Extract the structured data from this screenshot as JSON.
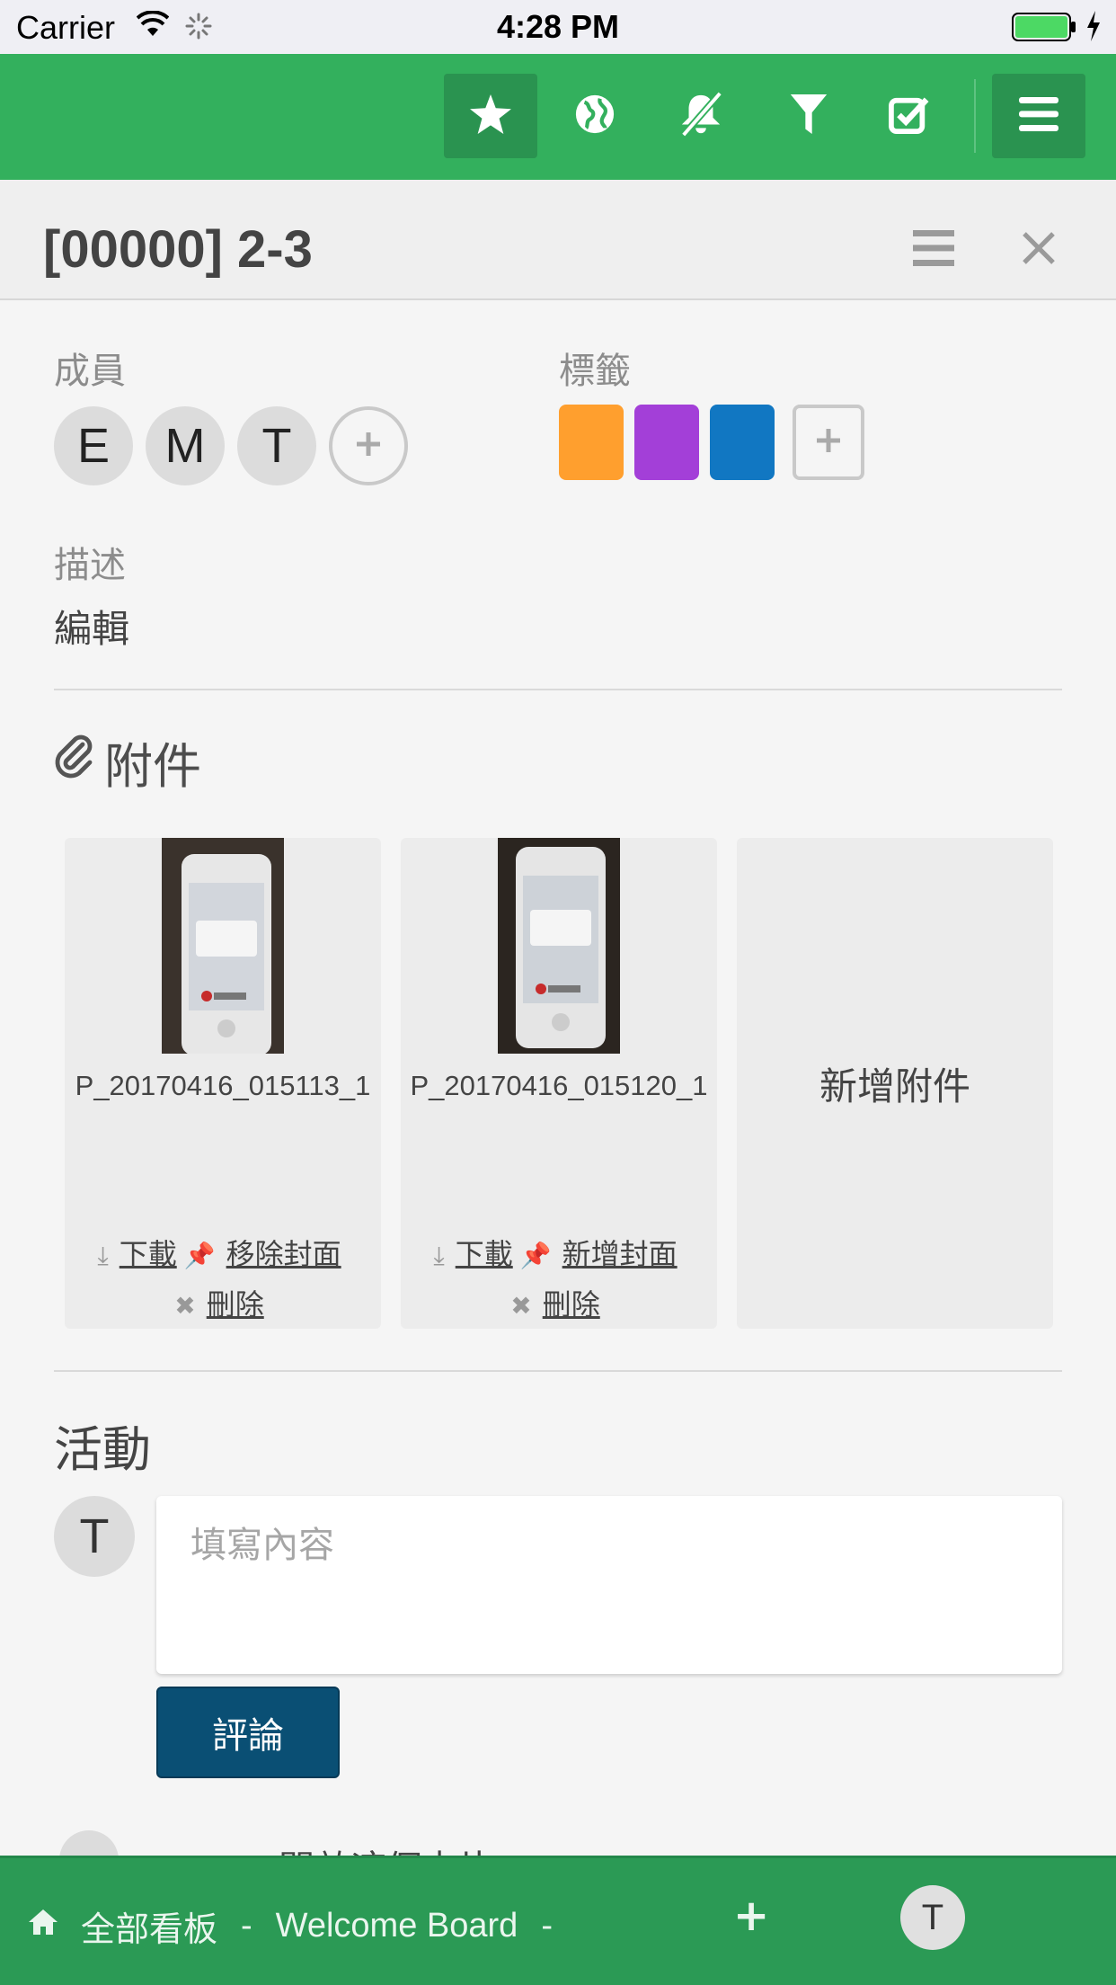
{
  "status_bar": {
    "carrier": "Carrier",
    "time": "4:28 PM"
  },
  "header": {
    "buttons": [
      "star-icon",
      "globe-icon",
      "bell-slash-icon",
      "filter-icon",
      "check-square-icon",
      "hamburger-icon"
    ],
    "brand_color": "#33b05d"
  },
  "card": {
    "title": "[00000] 2-3",
    "members_label": "成員",
    "members": [
      "E",
      "M",
      "T"
    ],
    "labels_label": "標籤",
    "label_colors": [
      "#ff9f2e",
      "#a33fd8",
      "#1177c2"
    ],
    "description_label": "描述",
    "edit_link": "編輯"
  },
  "attachments": {
    "title": "附件",
    "items": [
      {
        "name": "P_20170416_015113_1",
        "download": "下載",
        "cover_action": "移除封面",
        "delete": "刪除"
      },
      {
        "name": "P_20170416_015120_1",
        "download": "下載",
        "cover_action": "新增封面",
        "delete": "刪除"
      }
    ],
    "add_label": "新增附件"
  },
  "activity": {
    "title": "活動",
    "avatar": "T",
    "comment_placeholder": "填寫內容",
    "comment_button": "評論",
    "peek_text": "開啟這個卡片"
  },
  "footer": {
    "all_boards": "全部看板",
    "separator": "-",
    "board_name": "Welcome Board",
    "plus": "+",
    "avatar": "T"
  }
}
